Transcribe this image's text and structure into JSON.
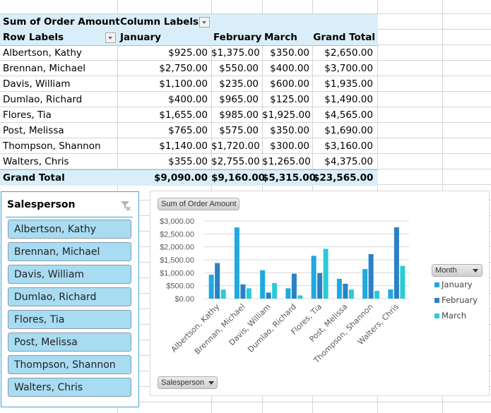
{
  "pivot": {
    "value_field": "Sum of Order Amount",
    "column_labels": "Column Labels",
    "row_labels": "Row Labels",
    "columns": [
      "January",
      "February",
      "March",
      "Grand Total"
    ],
    "rows": [
      {
        "name": "Albertson, Kathy",
        "values": [
          "$925.00",
          "$1,375.00",
          "$350.00",
          "$2,650.00"
        ]
      },
      {
        "name": "Brennan, Michael",
        "values": [
          "$2,750.00",
          "$550.00",
          "$400.00",
          "$3,700.00"
        ]
      },
      {
        "name": "Davis, William",
        "values": [
          "$1,100.00",
          "$235.00",
          "$600.00",
          "$1,935.00"
        ]
      },
      {
        "name": "Dumlao, Richard",
        "values": [
          "$400.00",
          "$965.00",
          "$125.00",
          "$1,490.00"
        ]
      },
      {
        "name": "Flores, Tia",
        "values": [
          "$1,655.00",
          "$985.00",
          "$1,925.00",
          "$4,565.00"
        ]
      },
      {
        "name": "Post, Melissa",
        "values": [
          "$765.00",
          "$575.00",
          "$350.00",
          "$1,690.00"
        ]
      },
      {
        "name": "Thompson, Shannon",
        "values": [
          "$1,140.00",
          "$1,720.00",
          "$300.00",
          "$3,160.00"
        ]
      },
      {
        "name": "Walters, Chris",
        "values": [
          "$355.00",
          "$2,755.00",
          "$1,265.00",
          "$4,375.00"
        ]
      }
    ],
    "grand_total": {
      "name": "Grand Total",
      "values": [
        "$9,090.00",
        "$9,160.00",
        "$5,315.00",
        "$23,565.00"
      ]
    }
  },
  "slicer": {
    "title": "Salesperson",
    "items": [
      "Albertson, Kathy",
      "Brennan, Michael",
      "Davis, William",
      "Dumlao, Richard",
      "Flores, Tia",
      "Post, Melissa",
      "Thompson, Shannon",
      "Walters, Chris"
    ],
    "color": "#a8dcf3"
  },
  "chart_buttons": {
    "value": "Sum of Order Amount",
    "axis": "Salesperson",
    "legend": "Month"
  },
  "chart_data": {
    "type": "bar",
    "title": "",
    "xlabel": "Salesperson",
    "ylabel": "Sum of Order Amount",
    "categories": [
      "Albertson, Kathy",
      "Brennan, Michael",
      "Davis, William",
      "Dumlao, Richard",
      "Flores, Tia",
      "Post, Melissa",
      "Thompson, Shannon",
      "Walters, Chris"
    ],
    "series": [
      {
        "name": "January",
        "color": "#1fa9e1",
        "values": [
          925,
          2750,
          1100,
          400,
          1655,
          765,
          1140,
          355
        ]
      },
      {
        "name": "February",
        "color": "#2981c6",
        "values": [
          1375,
          550,
          235,
          965,
          985,
          575,
          1720,
          2755
        ]
      },
      {
        "name": "March",
        "color": "#2bcbd6",
        "values": [
          350,
          400,
          600,
          125,
          1925,
          350,
          300,
          1265
        ]
      }
    ],
    "ylim": [
      0,
      3000
    ],
    "yticks": [
      "$0.00",
      "$500.00",
      "$1,000.00",
      "$1,500.00",
      "$2,000.00",
      "$2,500.00",
      "$3,000.00"
    ],
    "grid": true,
    "legend": "right"
  }
}
